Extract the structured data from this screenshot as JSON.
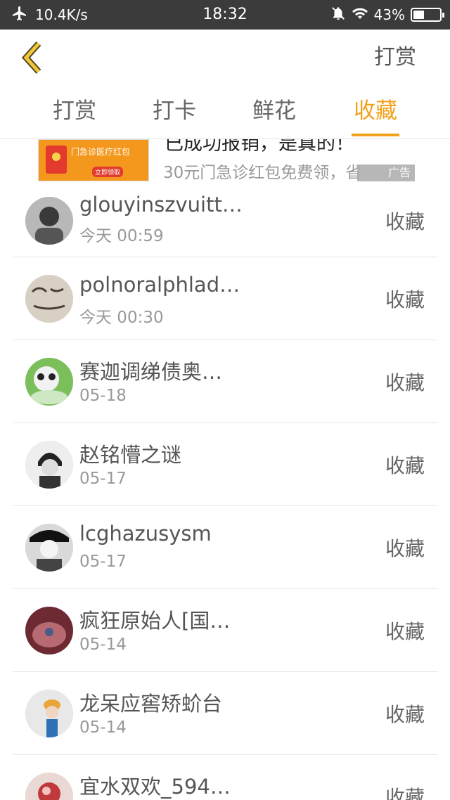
{
  "status_bar": {
    "speed": "10.4K/s",
    "time": "18:32",
    "battery": "43%",
    "battery_level": 0.43
  },
  "nav": {
    "action_label": "打赏"
  },
  "tabs": [
    {
      "label": "打赏",
      "active": false
    },
    {
      "label": "打卡",
      "active": false
    },
    {
      "label": "鲜花",
      "active": false
    },
    {
      "label": "收藏",
      "active": true
    }
  ],
  "ad": {
    "title": "已成功报销，是真的！",
    "description": "30元门急诊红包免费领，省",
    "badge": "广告",
    "image_text": "门急诊医疗红包",
    "image_button": "立即领取"
  },
  "list": [
    {
      "name": "glouyinszvuitt…",
      "date": "今天 00:59",
      "action": "收藏"
    },
    {
      "name": "polnoralphlad…",
      "date": "今天 00:30",
      "action": "收藏"
    },
    {
      "name": "赛迦调绨债奥…",
      "date": "05-18",
      "action": "收藏"
    },
    {
      "name": "赵铭懵之谜",
      "date": "05-17",
      "action": "收藏"
    },
    {
      "name": "lcghazusysm",
      "date": "05-17",
      "action": "收藏"
    },
    {
      "name": "疯狂原始人[国…",
      "date": "05-14",
      "action": "收藏"
    },
    {
      "name": "龙呆应窖矫蚧台",
      "date": "05-14",
      "action": "收藏"
    },
    {
      "name": "宜水双欢_594…",
      "date": "",
      "action": "收藏"
    }
  ],
  "colors": {
    "accent": "#f2a11b",
    "status_bar": "#3b3b3b"
  }
}
